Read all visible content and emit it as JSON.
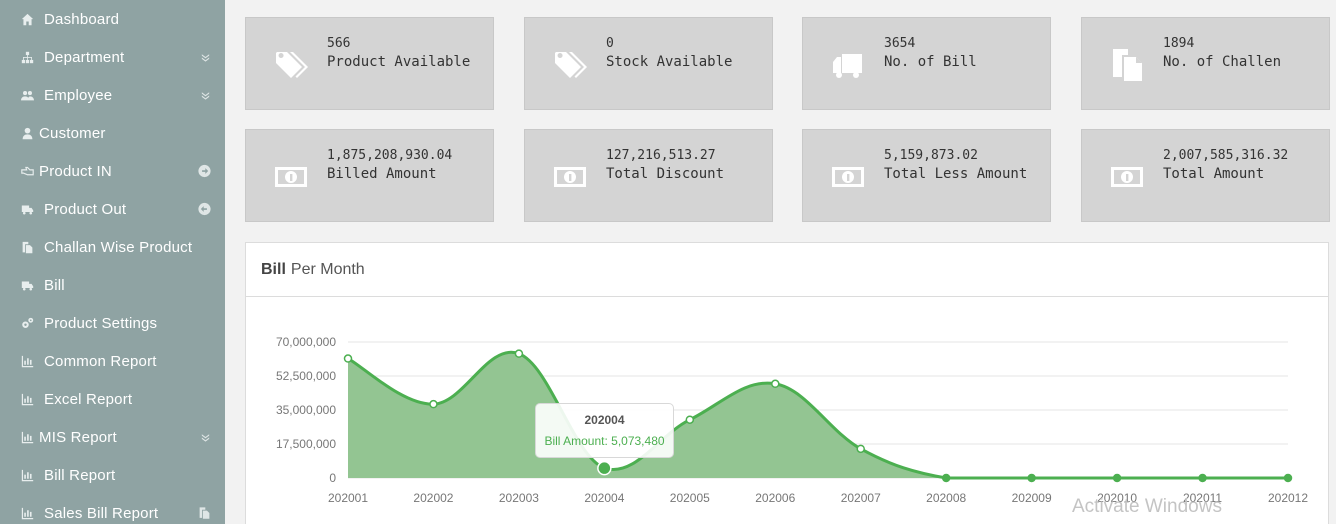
{
  "sidebar": {
    "items": [
      {
        "label": "Dashboard"
      },
      {
        "label": "Department"
      },
      {
        "label": "Employee"
      },
      {
        "label": "Customer"
      },
      {
        "label": "Product IN"
      },
      {
        "label": "Product Out"
      },
      {
        "label": "Challan Wise Product"
      },
      {
        "label": "Bill"
      },
      {
        "label": "Product Settings"
      },
      {
        "label": "Common Report"
      },
      {
        "label": "Excel Report"
      },
      {
        "label": "MIS Report"
      },
      {
        "label": "Bill Report"
      },
      {
        "label": "Sales Bill Report"
      }
    ]
  },
  "cards": [
    {
      "value": "566",
      "label": "Product Available",
      "icon": "tags-icon"
    },
    {
      "value": "0",
      "label": "Stock Available",
      "icon": "tags-icon"
    },
    {
      "value": "3654",
      "label": "No. of Bill",
      "icon": "truck-icon"
    },
    {
      "value": "1894",
      "label": "No. of Challen",
      "icon": "copy-icon"
    },
    {
      "value": "1,875,208,930.04",
      "label": "Billed Amount",
      "icon": "money-icon"
    },
    {
      "value": "127,216,513.27",
      "label": "Total Discount",
      "icon": "money-icon"
    },
    {
      "value": "5,159,873.02",
      "label": "Total Less Amount",
      "icon": "money-icon"
    },
    {
      "value": "2,007,585,316.32",
      "label": "Total Amount",
      "icon": "money-icon"
    }
  ],
  "panel": {
    "title_bold": "Bill",
    "title_rest": "Per Month"
  },
  "tooltip": {
    "title": "202004",
    "body": "Bill Amount: 5,073,480"
  },
  "watermark": "Activate Windows",
  "colors": {
    "sidebar_bg": "#8fa3a3",
    "card_bg": "#d4d4d4",
    "series_line": "#4caf50",
    "series_fill": "#93c592"
  },
  "chart_data": {
    "type": "area",
    "categories": [
      "202001",
      "202002",
      "202003",
      "202004",
      "202005",
      "202006",
      "202007",
      "202008",
      "202009",
      "202010",
      "202011",
      "202012"
    ],
    "series": [
      {
        "name": "Bill Amount",
        "values": [
          61500000,
          38000000,
          64000000,
          5073480,
          30000000,
          48500000,
          15000000,
          0,
          0,
          0,
          0,
          0
        ]
      }
    ],
    "yticks": [
      "0",
      "17,500,000",
      "35,000,000",
      "52,500,000",
      "70,000,000"
    ],
    "ytick_values": [
      0,
      17500000,
      35000000,
      52500000,
      70000000
    ],
    "ylim": [
      0,
      70000000
    ],
    "grid": true,
    "xlabel": "",
    "ylabel": ""
  }
}
